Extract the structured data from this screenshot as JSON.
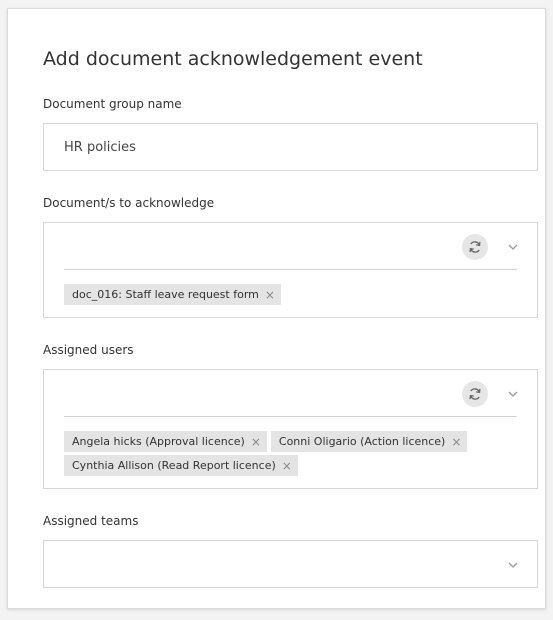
{
  "form": {
    "title": "Add document acknowledgement event",
    "document_group": {
      "label": "Document group name",
      "value": "HR policies"
    },
    "documents": {
      "label": "Document/s to acknowledge",
      "search_value": "",
      "selected": [
        "doc_016: Staff leave request form"
      ]
    },
    "assigned_users": {
      "label": "Assigned users",
      "search_value": "",
      "selected": [
        "Angela hicks (Approval licence)",
        "Conni Oligario (Action licence)",
        "Cynthia Allison (Read Report licence)"
      ]
    },
    "assigned_teams": {
      "label": "Assigned teams",
      "selected": []
    }
  },
  "icons": {
    "refresh": "refresh-icon",
    "chevron": "chevron-down-icon",
    "remove": "close-icon"
  },
  "glyphs": {
    "remove": "×"
  },
  "colors": {
    "chip_bg": "#e4e4e4",
    "border": "#d6d6d6",
    "refresh_bg": "#e6e6e6"
  }
}
